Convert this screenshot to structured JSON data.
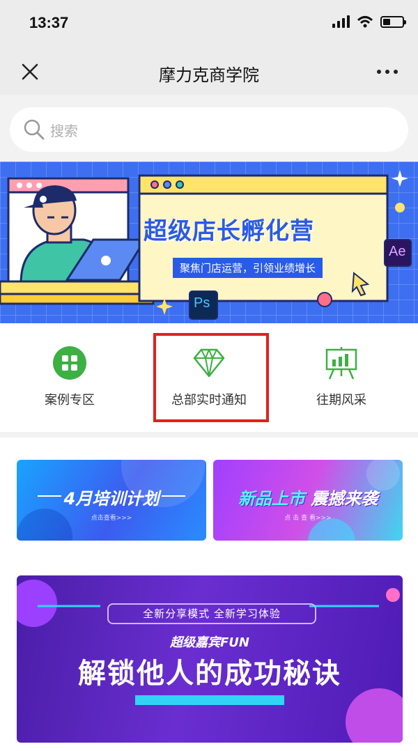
{
  "status_bar": {
    "time": "13:37"
  },
  "nav": {
    "title": "摩力克商学院",
    "close_icon": "close-icon",
    "more_icon": "more-icon"
  },
  "search": {
    "placeholder": "搜索"
  },
  "hero": {
    "title": "超级店长孵化营",
    "subtitle": "聚焦门店运营，引领业绩增长",
    "badges": [
      "Ae",
      "Ps"
    ]
  },
  "shortcuts": [
    {
      "label": "案例专区",
      "icon": "grid-icon",
      "color": "#3cb043"
    },
    {
      "label": "总部实时通知",
      "icon": "diamond-icon",
      "color": "#3cb043"
    },
    {
      "label": "往期风采",
      "icon": "presentation-board-icon",
      "color": "#3cb043"
    }
  ],
  "promos": [
    {
      "title": "4月培训计划",
      "sub": "点击查看>>>"
    },
    {
      "title_a": "新品上市",
      "title_b": "震撼来袭",
      "sub": "点 击 查 看>>>"
    }
  ],
  "banner": {
    "pill": "全新分享模式  全新学习体验",
    "sub": "超级嘉宾FUN",
    "title": "解锁他人的成功秘诀"
  },
  "colors": {
    "highlight": "#e02020",
    "hero_blue": "#3d6ff0",
    "accent_green": "#3cb043"
  }
}
